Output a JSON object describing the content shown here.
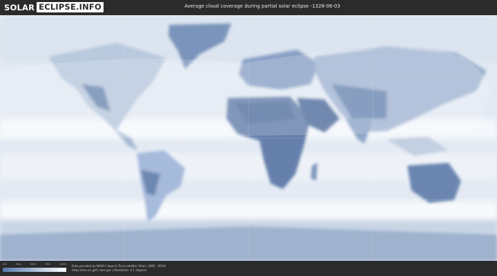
{
  "header": {
    "logo_part1": "SOLAR",
    "logo_part2": "ECLIPSE.INFO",
    "title": "Average cloud coverage during partial solar eclipse -1328-06-03"
  },
  "map": {
    "description_icon": "world-cloud-coverage-map",
    "colors": {
      "clear": "#ffffff",
      "low": "#d5e0ec",
      "mid": "#9db3cf",
      "cloudy_dark": "#6d88b0",
      "land_dark": "#5b78a4"
    }
  },
  "footer": {
    "scale_ticks": [
      "0%",
      "25%",
      "50%",
      "75%",
      "100%"
    ],
    "credit_line1": "Data provided by NASA's Aqua & Terra satellite (Years: 2000 - 2019)",
    "credit_line2": "https://neo.sci.gsfc.nasa.gov | Resolution: 0.1 degrees"
  }
}
